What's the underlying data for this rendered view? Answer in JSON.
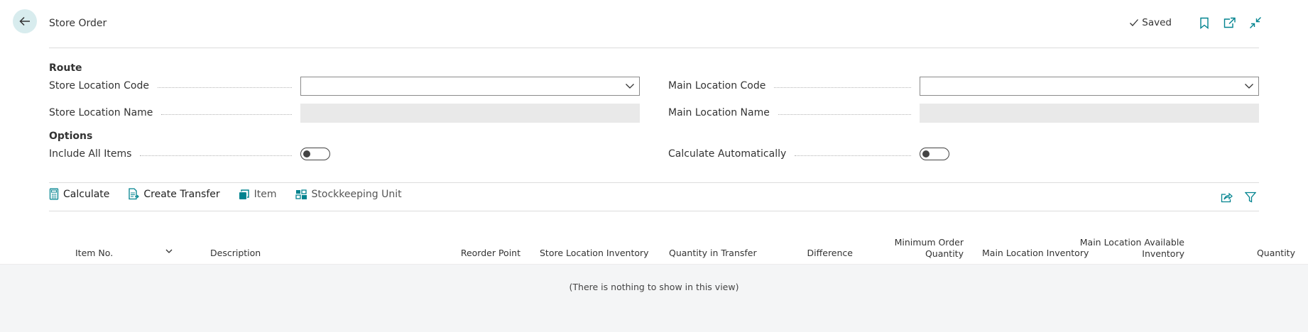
{
  "header": {
    "title": "Store Order",
    "saved_label": "Saved",
    "icons": [
      "back-arrow-icon",
      "checkmark-icon",
      "bookmark-icon",
      "open-new-window-icon",
      "collapse-icon"
    ]
  },
  "route": {
    "section_title": "Route",
    "store_location_code": {
      "label": "Store Location Code",
      "value": ""
    },
    "main_location_code": {
      "label": "Main Location Code",
      "value": ""
    },
    "store_location_name": {
      "label": "Store Location Name",
      "value": ""
    },
    "main_location_name": {
      "label": "Main Location Name",
      "value": ""
    }
  },
  "options": {
    "section_title": "Options",
    "include_all_items": {
      "label": "Include All Items",
      "on": false
    },
    "calculate_automatically": {
      "label": "Calculate Automatically",
      "on": false
    }
  },
  "actions": [
    {
      "label": "Calculate",
      "icon": "calculator-icon"
    },
    {
      "label": "Create Transfer",
      "icon": "document-icon"
    },
    {
      "label": "Item",
      "icon": "item-icon"
    },
    {
      "label": "Stockkeeping Unit",
      "icon": "stockkeeping-icon"
    }
  ],
  "action_right_icons": [
    "share-icon",
    "filter-icon"
  ],
  "table": {
    "columns": {
      "item_no": "Item No.",
      "description": "Description",
      "reorder_point": "Reorder Point",
      "store_location_inventory": "Store Location Inventory",
      "quantity_in_transfer": "Quantity in Transfer",
      "difference": "Difference",
      "minimum_order_quantity_l1": "Minimum Order",
      "minimum_order_quantity_l2": "Quantity",
      "main_location_inventory": "Main Location Inventory",
      "main_location_available_inventory_l1": "Main Location Available",
      "main_location_available_inventory_l2": "Inventory",
      "quantity": "Quantity"
    },
    "empty_message": "(There is nothing to show in this view)",
    "rows": []
  },
  "colors": {
    "accent": "#00838f",
    "back_button_bg": "#d8ecee",
    "readonly_bg": "#e9e9e9",
    "grid_bg": "#f4f5f6"
  }
}
